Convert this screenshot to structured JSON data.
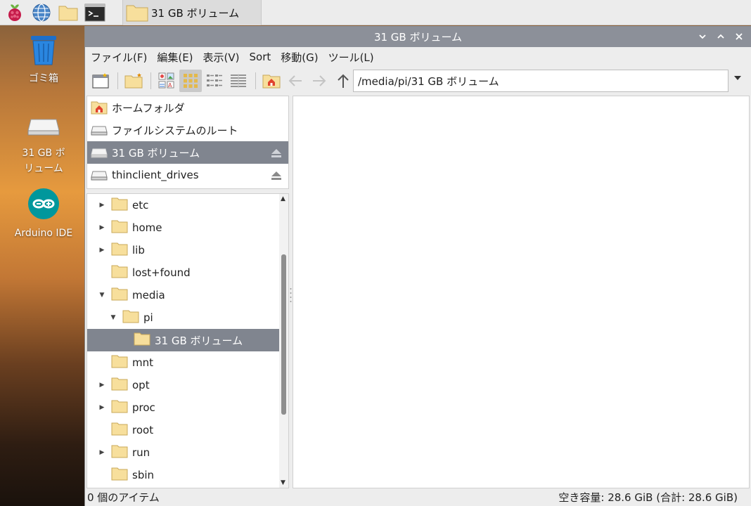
{
  "taskbar": {
    "task_label": "31 GB ボリューム",
    "icons": [
      "raspberry-menu-icon",
      "web-browser-icon",
      "file-manager-icon",
      "terminal-icon"
    ]
  },
  "desktop": {
    "icons": [
      {
        "label": "ゴミ箱",
        "icon": "trash-icon"
      },
      {
        "label": "31 GB ボ\nリューム",
        "icon": "drive-icon"
      },
      {
        "label": "Arduino IDE",
        "icon": "arduino-icon"
      }
    ]
  },
  "window": {
    "title": "31 GB ボリューム",
    "menu": [
      "ファイル(F)",
      "編集(E)",
      "表示(V)",
      "Sort",
      "移動(G)",
      "ツール(L)"
    ],
    "path": "/media/pi/31 GB ボリューム",
    "places": [
      {
        "label": "ホームフォルダ",
        "icon": "home-folder-icon",
        "selected": false,
        "eject": false
      },
      {
        "label": "ファイルシステムのルート",
        "icon": "drive-icon",
        "selected": false,
        "eject": false
      },
      {
        "label": "31 GB ボリューム",
        "icon": "drive-icon",
        "selected": true,
        "eject": true
      },
      {
        "label": "thinclient_drives",
        "icon": "drive-icon",
        "selected": false,
        "eject": true
      }
    ],
    "tree": [
      {
        "name": "etc",
        "level": 0,
        "expander": "collapsed"
      },
      {
        "name": "home",
        "level": 0,
        "expander": "collapsed"
      },
      {
        "name": "lib",
        "level": 0,
        "expander": "collapsed"
      },
      {
        "name": "lost+found",
        "level": 0,
        "expander": "none"
      },
      {
        "name": "media",
        "level": 0,
        "expander": "expanded"
      },
      {
        "name": "pi",
        "level": 1,
        "expander": "expanded"
      },
      {
        "name": "31 GB ボリューム",
        "level": 2,
        "expander": "none",
        "selected": true
      },
      {
        "name": "mnt",
        "level": 0,
        "expander": "none"
      },
      {
        "name": "opt",
        "level": 0,
        "expander": "collapsed"
      },
      {
        "name": "proc",
        "level": 0,
        "expander": "collapsed"
      },
      {
        "name": "root",
        "level": 0,
        "expander": "none"
      },
      {
        "name": "run",
        "level": 0,
        "expander": "collapsed"
      },
      {
        "name": "sbin",
        "level": 0,
        "expander": "none"
      }
    ],
    "status_left": "0 個のアイテム",
    "status_right": "空き容量: 28.6 GiB (合計: 28.6 GiB)"
  },
  "colors": {
    "titlebar": "#8c9099",
    "selection": "#80858f",
    "folder": "#f7df9c"
  }
}
